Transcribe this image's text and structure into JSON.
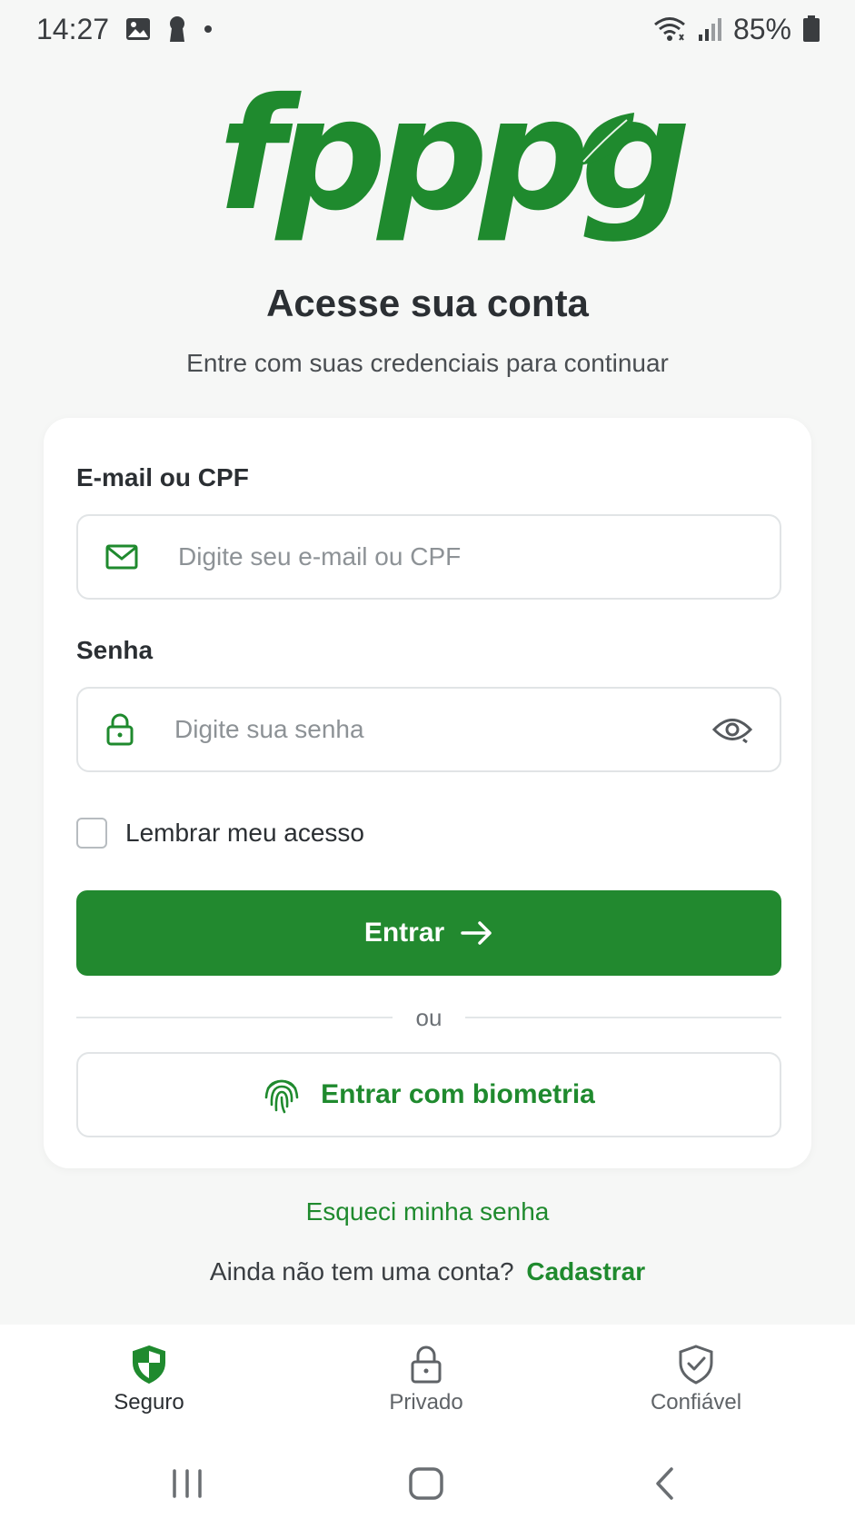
{
  "status_bar": {
    "time": "14:27",
    "battery": "85%"
  },
  "logo": {
    "text": "fpppg"
  },
  "header": {
    "title": "Acesse sua conta",
    "subtitle": "Entre com suas credenciais para continuar"
  },
  "form": {
    "email": {
      "label": "E-mail ou CPF",
      "placeholder": "Digite seu e-mail ou CPF",
      "value": ""
    },
    "password": {
      "label": "Senha",
      "placeholder": "Digite sua senha",
      "value": ""
    },
    "remember_label": "Lembrar meu acesso",
    "submit_label": "Entrar",
    "divider_text": "ou",
    "biometric_label": "Entrar com biometria"
  },
  "links": {
    "forgot": "Esqueci minha senha",
    "signup_prompt": "Ainda não tem uma conta?",
    "signup": "Cadastrar"
  },
  "trust_bar": [
    {
      "label": "Seguro",
      "icon": "shield-icon"
    },
    {
      "label": "Privado",
      "icon": "lock-icon"
    },
    {
      "label": "Confiável",
      "icon": "shield-check-icon"
    }
  ],
  "colors": {
    "brand": "#22892f",
    "link": "#1f8a2e",
    "background": "#f6f7f6"
  }
}
